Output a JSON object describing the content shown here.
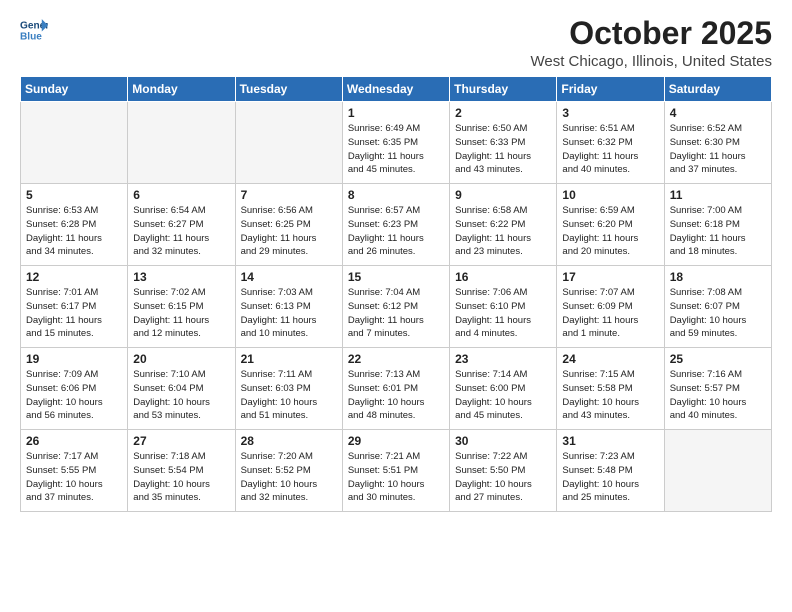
{
  "header": {
    "logo_line1": "General",
    "logo_line2": "Blue",
    "month": "October 2025",
    "location": "West Chicago, Illinois, United States"
  },
  "weekdays": [
    "Sunday",
    "Monday",
    "Tuesday",
    "Wednesday",
    "Thursday",
    "Friday",
    "Saturday"
  ],
  "weeks": [
    [
      {
        "day": "",
        "info": ""
      },
      {
        "day": "",
        "info": ""
      },
      {
        "day": "",
        "info": ""
      },
      {
        "day": "1",
        "info": "Sunrise: 6:49 AM\nSunset: 6:35 PM\nDaylight: 11 hours\nand 45 minutes."
      },
      {
        "day": "2",
        "info": "Sunrise: 6:50 AM\nSunset: 6:33 PM\nDaylight: 11 hours\nand 43 minutes."
      },
      {
        "day": "3",
        "info": "Sunrise: 6:51 AM\nSunset: 6:32 PM\nDaylight: 11 hours\nand 40 minutes."
      },
      {
        "day": "4",
        "info": "Sunrise: 6:52 AM\nSunset: 6:30 PM\nDaylight: 11 hours\nand 37 minutes."
      }
    ],
    [
      {
        "day": "5",
        "info": "Sunrise: 6:53 AM\nSunset: 6:28 PM\nDaylight: 11 hours\nand 34 minutes."
      },
      {
        "day": "6",
        "info": "Sunrise: 6:54 AM\nSunset: 6:27 PM\nDaylight: 11 hours\nand 32 minutes."
      },
      {
        "day": "7",
        "info": "Sunrise: 6:56 AM\nSunset: 6:25 PM\nDaylight: 11 hours\nand 29 minutes."
      },
      {
        "day": "8",
        "info": "Sunrise: 6:57 AM\nSunset: 6:23 PM\nDaylight: 11 hours\nand 26 minutes."
      },
      {
        "day": "9",
        "info": "Sunrise: 6:58 AM\nSunset: 6:22 PM\nDaylight: 11 hours\nand 23 minutes."
      },
      {
        "day": "10",
        "info": "Sunrise: 6:59 AM\nSunset: 6:20 PM\nDaylight: 11 hours\nand 20 minutes."
      },
      {
        "day": "11",
        "info": "Sunrise: 7:00 AM\nSunset: 6:18 PM\nDaylight: 11 hours\nand 18 minutes."
      }
    ],
    [
      {
        "day": "12",
        "info": "Sunrise: 7:01 AM\nSunset: 6:17 PM\nDaylight: 11 hours\nand 15 minutes."
      },
      {
        "day": "13",
        "info": "Sunrise: 7:02 AM\nSunset: 6:15 PM\nDaylight: 11 hours\nand 12 minutes."
      },
      {
        "day": "14",
        "info": "Sunrise: 7:03 AM\nSunset: 6:13 PM\nDaylight: 11 hours\nand 10 minutes."
      },
      {
        "day": "15",
        "info": "Sunrise: 7:04 AM\nSunset: 6:12 PM\nDaylight: 11 hours\nand 7 minutes."
      },
      {
        "day": "16",
        "info": "Sunrise: 7:06 AM\nSunset: 6:10 PM\nDaylight: 11 hours\nand 4 minutes."
      },
      {
        "day": "17",
        "info": "Sunrise: 7:07 AM\nSunset: 6:09 PM\nDaylight: 11 hours\nand 1 minute."
      },
      {
        "day": "18",
        "info": "Sunrise: 7:08 AM\nSunset: 6:07 PM\nDaylight: 10 hours\nand 59 minutes."
      }
    ],
    [
      {
        "day": "19",
        "info": "Sunrise: 7:09 AM\nSunset: 6:06 PM\nDaylight: 10 hours\nand 56 minutes."
      },
      {
        "day": "20",
        "info": "Sunrise: 7:10 AM\nSunset: 6:04 PM\nDaylight: 10 hours\nand 53 minutes."
      },
      {
        "day": "21",
        "info": "Sunrise: 7:11 AM\nSunset: 6:03 PM\nDaylight: 10 hours\nand 51 minutes."
      },
      {
        "day": "22",
        "info": "Sunrise: 7:13 AM\nSunset: 6:01 PM\nDaylight: 10 hours\nand 48 minutes."
      },
      {
        "day": "23",
        "info": "Sunrise: 7:14 AM\nSunset: 6:00 PM\nDaylight: 10 hours\nand 45 minutes."
      },
      {
        "day": "24",
        "info": "Sunrise: 7:15 AM\nSunset: 5:58 PM\nDaylight: 10 hours\nand 43 minutes."
      },
      {
        "day": "25",
        "info": "Sunrise: 7:16 AM\nSunset: 5:57 PM\nDaylight: 10 hours\nand 40 minutes."
      }
    ],
    [
      {
        "day": "26",
        "info": "Sunrise: 7:17 AM\nSunset: 5:55 PM\nDaylight: 10 hours\nand 37 minutes."
      },
      {
        "day": "27",
        "info": "Sunrise: 7:18 AM\nSunset: 5:54 PM\nDaylight: 10 hours\nand 35 minutes."
      },
      {
        "day": "28",
        "info": "Sunrise: 7:20 AM\nSunset: 5:52 PM\nDaylight: 10 hours\nand 32 minutes."
      },
      {
        "day": "29",
        "info": "Sunrise: 7:21 AM\nSunset: 5:51 PM\nDaylight: 10 hours\nand 30 minutes."
      },
      {
        "day": "30",
        "info": "Sunrise: 7:22 AM\nSunset: 5:50 PM\nDaylight: 10 hours\nand 27 minutes."
      },
      {
        "day": "31",
        "info": "Sunrise: 7:23 AM\nSunset: 5:48 PM\nDaylight: 10 hours\nand 25 minutes."
      },
      {
        "day": "",
        "info": ""
      }
    ]
  ]
}
